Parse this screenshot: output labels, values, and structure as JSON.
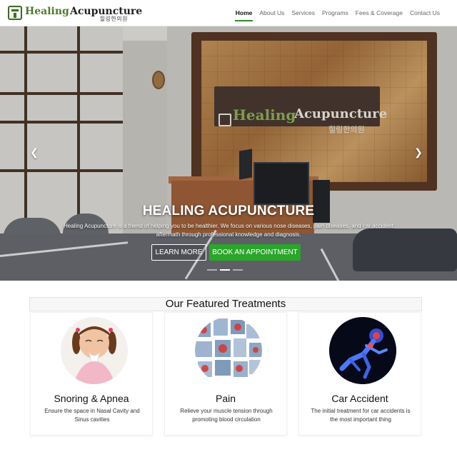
{
  "brand": {
    "name_part1": "Healing",
    "name_part2": "Acupuncture",
    "korean": "힐링한의원"
  },
  "nav": {
    "items": [
      {
        "label": "Home",
        "active": true
      },
      {
        "label": "About Us",
        "active": false
      },
      {
        "label": "Services",
        "active": false
      },
      {
        "label": "Programs",
        "active": false
      },
      {
        "label": "Fees & Coverage",
        "active": false
      },
      {
        "label": "Contact Us",
        "active": false
      }
    ]
  },
  "hero": {
    "title": "HEALING ACUPUNCTURE",
    "text": "Healing Acupuncture is a friend of helping you to be healthier. We focus on various nose diseases, pain diseases, and car accident aftermath through professional knowledge and diagnosis.",
    "learn_more": "LEARN MORE",
    "book": "BOOK AN APPOINTMENT",
    "prev_icon": "chevron-left-icon",
    "next_icon": "chevron-right-icon",
    "sign_healing": "Healing",
    "sign_acupuncture": "Acupuncture",
    "sign_korean": "힐링한의원",
    "slides": 3,
    "active_slide": 2
  },
  "featured": {
    "heading": "Our Featured Treatments",
    "cards": [
      {
        "title": "Snoring & Apnea",
        "desc": "Ensure the space in Nasal Cavity and Sinus cavities",
        "image": "sneezing-child-photo"
      },
      {
        "title": "Pain",
        "desc": "Relieve your muscle tension through promoting blood circulation",
        "image": "body-pain-collage-photo"
      },
      {
        "title": "Car Accident",
        "desc": "The initial treatment for car accidents is the most important thing",
        "image": "xray-skeleton-photo"
      }
    ]
  },
  "colors": {
    "accent_green": "#2aa62a",
    "brand_green": "#4f7a2c",
    "nav_underline": "#2e8b2e"
  }
}
